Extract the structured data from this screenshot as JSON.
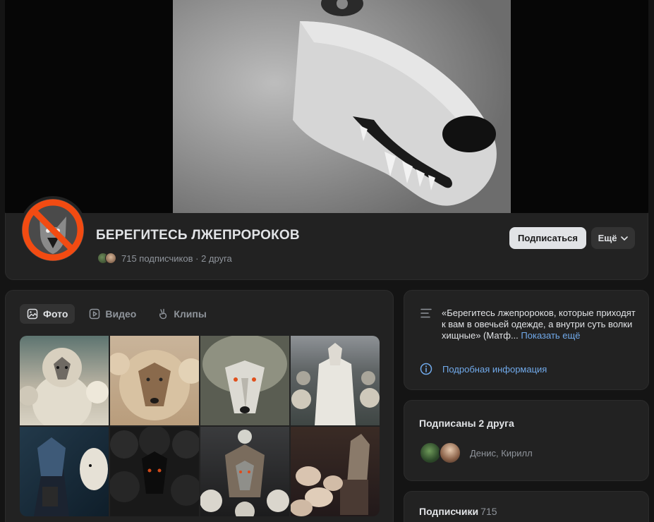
{
  "group": {
    "title": "БЕРЕГИТЕСЬ ЛЖЕПРОРОКОВ",
    "subscribers": "715 подписчиков",
    "separator": " · ",
    "friends": "2 друга"
  },
  "actions": {
    "subscribe_label": "Подписаться",
    "more_label": "Ещё"
  },
  "media": {
    "tabs": [
      {
        "label": "Фото",
        "icon": "image-icon",
        "active": true
      },
      {
        "label": "Видео",
        "icon": "play-icon",
        "active": false
      },
      {
        "label": "Клипы",
        "icon": "clips-icon",
        "active": false
      }
    ]
  },
  "about": {
    "description": "«Берегитесь лжепророков, которые приходят к вам в овечьей одежде, а внутри суть волки хищные» (Матф...",
    "show_more": "Показать ещё",
    "details_link": "Подробная информация"
  },
  "friends_block": {
    "title": "Подписаны 2 друга",
    "names": "Денис, Кирилл"
  },
  "subscribers_block": {
    "title": "Подписчики",
    "count": "715"
  },
  "colors": {
    "background": "#141414",
    "card": "#222222",
    "accent_link": "#71aaeb",
    "muted_text": "#8f949b",
    "primary_text": "#e1e3e6"
  }
}
